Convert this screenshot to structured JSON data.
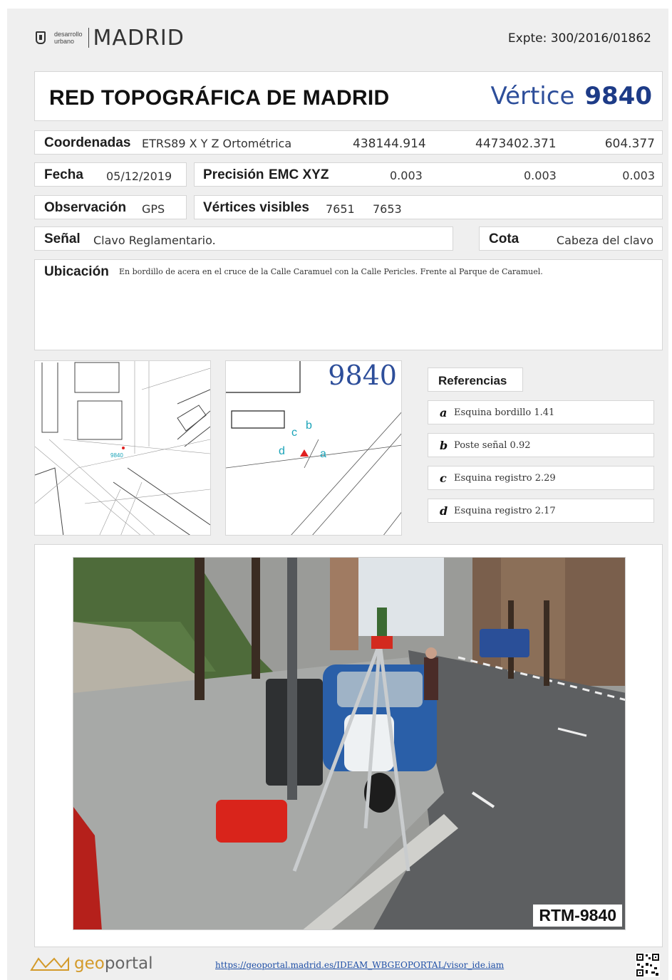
{
  "header": {
    "logo_small_1": "desarrollo",
    "logo_small_2": "urbano",
    "logo_name": "MADRID",
    "expte": "Expte:  300/2016/01862"
  },
  "title": {
    "main": "RED TOPOGRÁFICA DE MADRID",
    "vertice_label": "Vértice",
    "vertice_number": "9840"
  },
  "coordenadas": {
    "label": "Coordenadas",
    "system": "ETRS89 X Y Z Ortométrica",
    "x": "438144.914",
    "y": "4473402.371",
    "z": "604.377"
  },
  "fecha": {
    "label": "Fecha",
    "value": "05/12/2019"
  },
  "precision": {
    "label": "Precisión",
    "type": "EMC XYZ",
    "x": "0.003",
    "y": "0.003",
    "z": "0.003"
  },
  "observacion": {
    "label": "Observación",
    "value": "GPS"
  },
  "vertices_visibles": {
    "label": "Vértices visibles",
    "v1": "7651",
    "v2": "7653"
  },
  "senal": {
    "label": "Señal",
    "value": "Clavo Reglamentario."
  },
  "cota": {
    "label": "Cota",
    "value": "Cabeza del clavo"
  },
  "ubicacion": {
    "label": "Ubicación",
    "value": "En bordillo de acera en el cruce de la Calle Caramuel con la Calle Pericles. Frente al Parque de Caramuel."
  },
  "map_overview": {
    "marker_label": "9840"
  },
  "croquis": {
    "number": "9840",
    "point_labels": [
      "a",
      "b",
      "c",
      "d"
    ]
  },
  "referencias": {
    "title": "Referencias",
    "items": [
      {
        "letter": "a",
        "text": "Esquina bordillo  1.41"
      },
      {
        "letter": "b",
        "text": "Poste señal  0.92"
      },
      {
        "letter": "c",
        "text": "Esquina registro  2.29"
      },
      {
        "letter": "d",
        "text": "Esquina registro  2.17"
      }
    ]
  },
  "photo": {
    "caption": "RTM-9840"
  },
  "footer": {
    "logo_text_1": "geo",
    "logo_text_2": "portal",
    "url": "https://geoportal.madrid.es/IDEAM_WBGEOPORTAL/visor_ide.iam"
  },
  "colors": {
    "vertice_blue": "#2d4e9a",
    "map_label_cyan": "#1aa3b8",
    "marker_red": "#e02020",
    "link_blue": "#1f4fa6",
    "geoportal_orange": "#d39a2a"
  }
}
